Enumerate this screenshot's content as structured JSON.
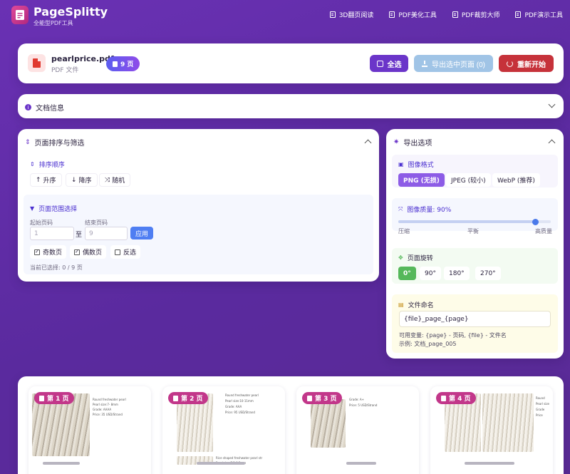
{
  "app": {
    "name": "PageSplitty",
    "tagline": "全能型PDF工具"
  },
  "nav": [
    {
      "label": "3D翻页阅读",
      "icon": "book-icon"
    },
    {
      "label": "PDF美化工具",
      "icon": "magic-icon"
    },
    {
      "label": "PDF裁剪大师",
      "icon": "crop-icon"
    },
    {
      "label": "PDF演示工具",
      "icon": "presentation-icon"
    }
  ],
  "file": {
    "name": "pearlprice.pdf",
    "type": "PDF 文件",
    "pages": "9 页"
  },
  "actions": {
    "select_all": "全选",
    "export": "导出选中页面 (0)",
    "reset": "重新开始"
  },
  "doc_info": {
    "title": "文档信息"
  },
  "sort": {
    "title": "页面排序与筛选",
    "order_title": "排序顺序",
    "asc": "升序",
    "desc": "降序",
    "random": "随机",
    "range_title": "页面范围选择",
    "start_label": "起始页码",
    "start_placeholder": "1",
    "to": "至",
    "end_label": "结束页码",
    "end_placeholder": "9",
    "apply": "应用",
    "odd": "奇数页",
    "even": "偶数页",
    "invert": "反选",
    "selected": "当前已选择: 0 / 9 页"
  },
  "export": {
    "title": "导出选项",
    "format_title": "图像格式",
    "formats": [
      "PNG (无损)",
      "JPEG (较小)",
      "WebP (推荐)"
    ],
    "format_selected": "PNG (无损)",
    "quality_title": "图像质量: 90%",
    "quality": 0.9,
    "quality_min": "压缩",
    "quality_mid": "平衡",
    "quality_max": "高质量",
    "rotation_title": "页面旋转",
    "rotations": [
      "0°",
      "90°",
      "180°",
      "270°"
    ],
    "rotation_selected": "0°",
    "naming_title": "文件命名",
    "naming_value": "{file}_page_{page}",
    "naming_vars": "可用变量: {page} - 页码, {file} - 文件名",
    "naming_example": "示例: 文档_page_005"
  },
  "thumbnails": [
    {
      "badge": "第 1 页",
      "lines": [
        "Round freshwater pearl",
        "Pearl size:7- 8mm",
        "Grade:    AAAA",
        "Price:  35 USD/Strand"
      ]
    },
    {
      "badge": "第 2 页",
      "lines": [
        "Round freshwater pearl",
        "Pearl size:10-11mm",
        "Grade:    AAA",
        "Price:  95 USD/Strand"
      ],
      "lines_b": [
        "Rice shaped freshwater pearl str",
        "Pearl size:7.5-8.5mm"
      ]
    },
    {
      "badge": "第 3 页",
      "lines": [
        "Grade:  A+",
        "Price:  5 USD/Strand"
      ]
    },
    {
      "badge": "第 4 页",
      "lines": [
        "Round",
        "Pearl size",
        "Grade",
        "Price"
      ]
    }
  ],
  "colors": {
    "primary": "#6b35c9",
    "danger": "#c6323a",
    "export_disabled": "#a0c4e6",
    "badge": "#c2378a"
  }
}
